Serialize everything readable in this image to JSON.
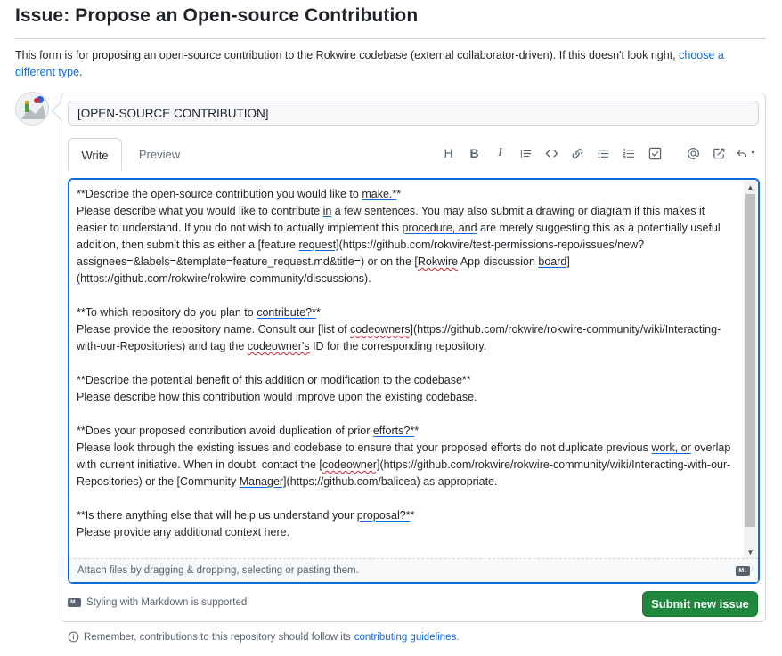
{
  "page": {
    "title": "Issue: Propose an Open-source Contribution",
    "intro_text": "This form is for proposing an open-source contribution to the Rokwire codebase (external collaborator-driven). If this doesn't look right,",
    "intro_link": "choose a different type",
    "intro_end": "."
  },
  "form": {
    "title_value": "[OPEN-SOURCE CONTRIBUTION]",
    "tabs": [
      {
        "label": "Write"
      },
      {
        "label": "Preview"
      }
    ],
    "toolbar_icons": [
      "heading-icon",
      "bold-icon",
      "italic-icon",
      "quote-icon",
      "code-icon",
      "link-icon",
      "bulleted-list-icon",
      "numbered-list-icon",
      "task-list-icon",
      "mention-icon",
      "cross-reference-icon",
      "undo-icon"
    ],
    "body": {
      "l1": "**Describe the open-source contribution you would like to",
      "l1_spell": "make.*",
      "l1_end": "*",
      "p1a": "Please describe what you would like to contribute",
      "p1a_spell": "in",
      "p1b": "a few sentences. You may also submit a drawing or diagram if this makes it easier to understand. If you do not wish to actually implement this",
      "p1b_spell": "procedure, and",
      "p1c": "are merely suggesting this as a potentially useful addition, then submit this as either a [feature",
      "p1c_spell": "request]",
      "p1d": "(https://github.com/rokwire/test-permissions-repo/issues/new?assignees=&labels=&template=feature_request.md&title=) or on the [",
      "p1d_spell": "Rokwire",
      "p1e": "App discussion",
      "p1e_spell": "board]",
      "p1f_spell": "(",
      "p1f": "https://github.com/rokwire/rokwire-community/discussions).",
      "l2": "**To which repository do you plan to",
      "l2_spell": "contribute?*",
      "l2_end": "*",
      "p2a": "Please provide the repository name. Consult our [list of",
      "p2a_spell": "codeowners]",
      "p2b": "(https://github.com/rokwire/rokwire-community/wiki/Interacting-with-our-Repositories) and tag the",
      "p2b_spell": "codeowner's",
      "p2c": "ID for the corresponding repository.",
      "l3": "**Describe the potential benefit of this addition or modification to the codebase**",
      "p3": "Please describe how this contribution would improve upon the existing codebase.",
      "l4": "**Does your proposed contribution avoid duplication of prior",
      "l4_spell": "efforts?*",
      "l4_end": "*",
      "p4a": "Please look through the existing issues and codebase to ensure that your proposed efforts do not duplicate previous",
      "p4a_spell": "work, or",
      "p4b": "overlap with current initiative. When in doubt, contact the [",
      "p4b_spell": "codeowner]",
      "p4c": "(https://github.com/rokwire/rokwire-community/wiki/Interacting-with-our-Repositories) or the [Community",
      "p4c_spell": "Manager]",
      "p4d": "(https://github.com/balicea) as appropriate.",
      "l5": "**Is there anything else that will help us understand your",
      "l5_spell": "proposal?*",
      "l5_end": "*",
      "p5": "Please provide any additional context here."
    },
    "attach_text": "Attach files by dragging & dropping, selecting or pasting them.",
    "markdown_badge": "M↓",
    "markdown_note": "Styling with Markdown is supported",
    "submit_label": "Submit new issue"
  },
  "footer": {
    "note_text": "Remember, contributions to this repository should follow its",
    "note_link": "contributing guidelines",
    "note_end": "."
  },
  "colors": {
    "accent": "#0969da",
    "submit_green": "#1f883d",
    "border": "#d0d7de"
  }
}
